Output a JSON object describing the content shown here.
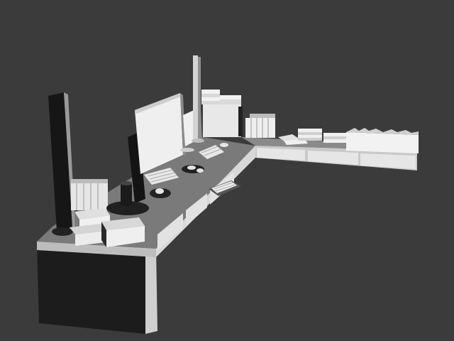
{
  "scene": {
    "subject": "untextured-3d-render",
    "colors": {
      "background": "#3b3b3b",
      "desk_top": "#7c7c7c",
      "desk_front": "#d0d0d0",
      "desk_side": "#1e1e1e",
      "white": "#ececec",
      "dark": "#1a1a1a"
    }
  }
}
